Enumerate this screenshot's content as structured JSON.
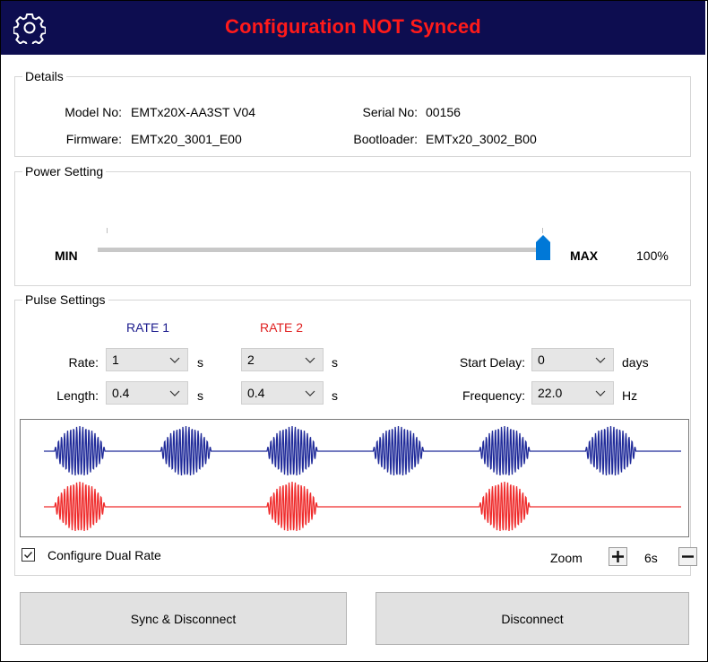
{
  "header": {
    "title": "Configuration NOT Synced",
    "title_color": "#ff1a1a",
    "bar_color": "#0d0d50",
    "settings_icon": "gear-icon"
  },
  "details": {
    "group_label": "Details",
    "model_label": "Model No:",
    "model_value": "EMTx20X-AA3ST  V04",
    "serial_label": "Serial No:",
    "serial_value": "00156",
    "firmware_label": "Firmware:",
    "firmware_value": "EMTx20_3001_E00",
    "bootloader_label": "Bootloader:",
    "bootloader_value": "EMTx20_3002_B00"
  },
  "power": {
    "group_label": "Power Setting",
    "min_label": "MIN",
    "max_label": "MAX",
    "percent_label": "100%",
    "level": 1.0,
    "thumb_color": "#0078d7"
  },
  "pulse": {
    "group_label": "Pulse Settings",
    "rate1_header": "RATE 1",
    "rate2_header": "RATE 2",
    "rate1_color": "#1a1a8c",
    "rate2_color": "#e02020",
    "rate_label": "Rate:",
    "length_label": "Length:",
    "unit_s": "s",
    "rate1_rate": "1",
    "rate1_length": "0.4",
    "rate2_rate": "2",
    "rate2_length": "0.4",
    "start_delay_label": "Start Delay:",
    "start_delay_value": "0",
    "start_delay_unit": "days",
    "frequency_label": "Frequency:",
    "frequency_value": "22.0",
    "frequency_unit": "Hz"
  },
  "waveform": {
    "rate1_color": "#1f2a99",
    "rate2_color": "#ef2b2b"
  },
  "footer": {
    "dual_rate_label": "Configure Dual Rate",
    "dual_rate_checked": true,
    "zoom_label": "Zoom",
    "zoom_value": "6s",
    "plus_symbol": "+",
    "minus_symbol": "—"
  },
  "buttons": {
    "sync_label": "Sync & Disconnect",
    "disconnect_label": "Disconnect"
  }
}
